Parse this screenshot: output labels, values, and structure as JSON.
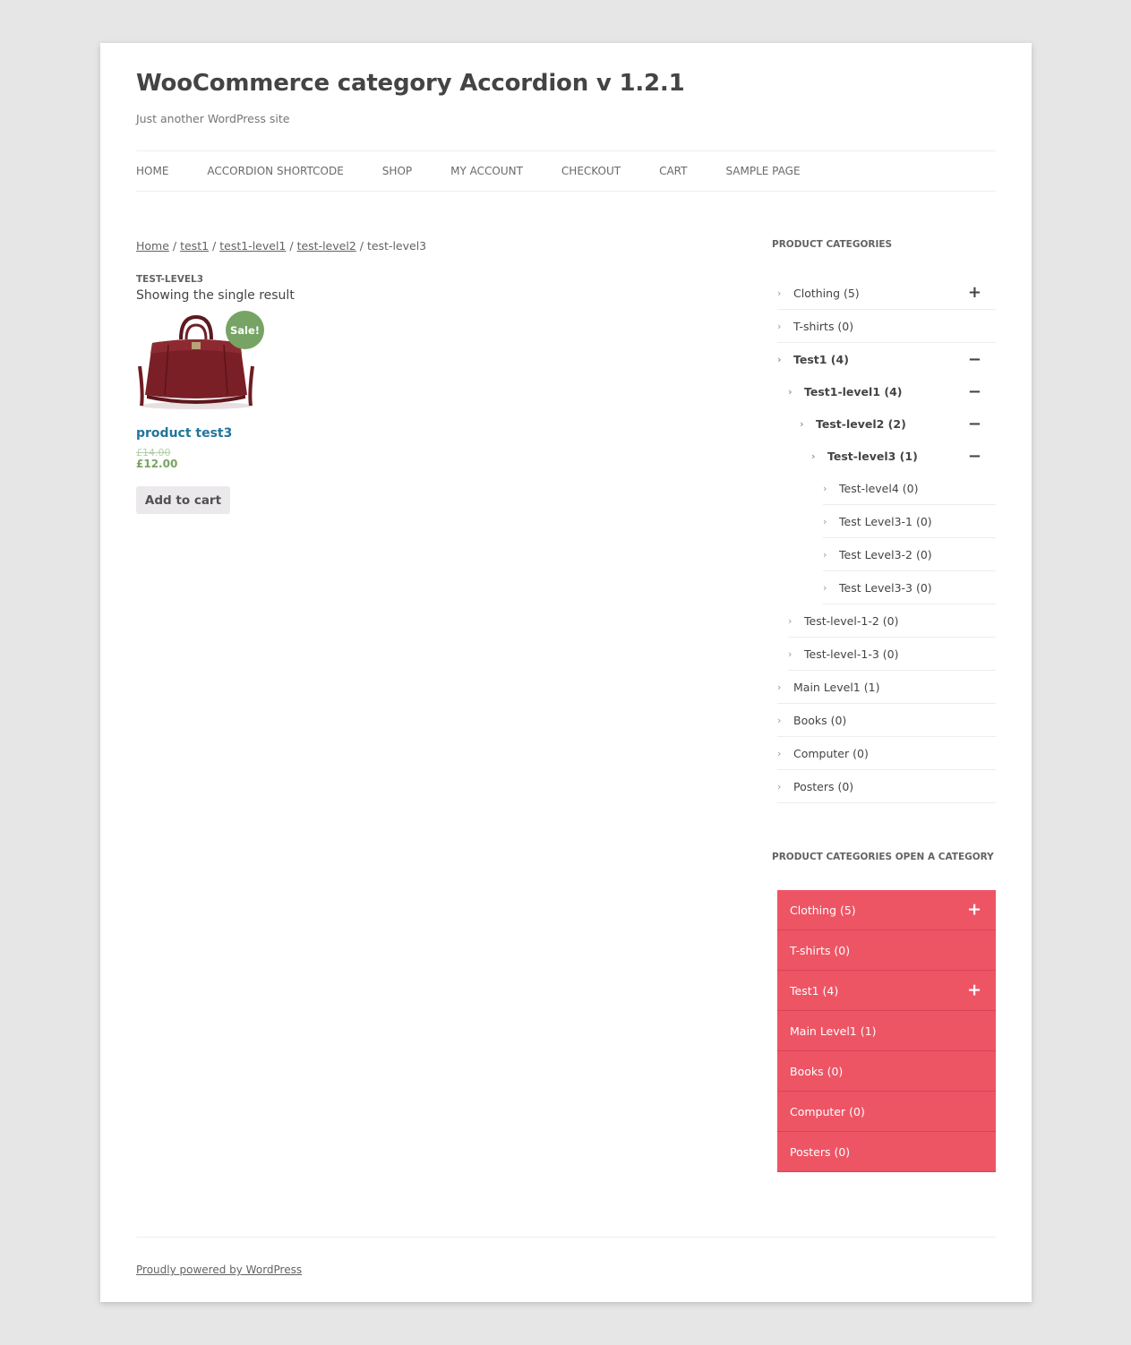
{
  "site": {
    "title": "WooCommerce category Accordion v 1.2.1",
    "description": "Just another WordPress site"
  },
  "nav": [
    "HOME",
    "ACCORDION SHORTCODE",
    "SHOP",
    "MY ACCOUNT",
    "CHECKOUT",
    "CART",
    "SAMPLE PAGE"
  ],
  "breadcrumb": {
    "links": [
      "Home",
      "test1",
      "test1-level1",
      "test-level2"
    ],
    "current": "test-level3",
    "separator": " / "
  },
  "archive": {
    "title": "TEST-LEVEL3",
    "result_count": "Showing the single result"
  },
  "product": {
    "name": "product test3",
    "sale_badge": "Sale!",
    "old_price": "£14.00",
    "new_price": "£12.00",
    "add_to_cart": "Add to cart",
    "image_icon": "handbag-image"
  },
  "widget1": {
    "title": "PRODUCT CATEGORIES",
    "items": [
      {
        "label": "Clothing (5)",
        "level": 0,
        "toggle": "+",
        "active": false
      },
      {
        "label": "T-shirts (0)",
        "level": 0,
        "toggle": "",
        "active": false
      },
      {
        "label": "Test1 (4)",
        "level": 0,
        "toggle": "−",
        "active": true
      },
      {
        "label": "Test1-level1 (4)",
        "level": 1,
        "toggle": "−",
        "active": true
      },
      {
        "label": "Test-level2 (2)",
        "level": 2,
        "toggle": "−",
        "active": true
      },
      {
        "label": "Test-level3 (1)",
        "level": 3,
        "toggle": "−",
        "active": true
      },
      {
        "label": "Test-level4 (0)",
        "level": 4,
        "toggle": "",
        "active": false
      },
      {
        "label": "Test Level3-1 (0)",
        "level": 4,
        "toggle": "",
        "active": false
      },
      {
        "label": "Test Level3-2 (0)",
        "level": 4,
        "toggle": "",
        "active": false
      },
      {
        "label": "Test Level3-3 (0)",
        "level": 4,
        "toggle": "",
        "active": false
      },
      {
        "label": "Test-level-1-2 (0)",
        "level": 1,
        "toggle": "",
        "active": false
      },
      {
        "label": "Test-level-1-3 (0)",
        "level": 1,
        "toggle": "",
        "active": false
      },
      {
        "label": "Main Level1 (1)",
        "level": 0,
        "toggle": "",
        "active": false
      },
      {
        "label": "Books (0)",
        "level": 0,
        "toggle": "",
        "active": false
      },
      {
        "label": "Computer (0)",
        "level": 0,
        "toggle": "",
        "active": false
      },
      {
        "label": "Posters (0)",
        "level": 0,
        "toggle": "",
        "active": false
      }
    ]
  },
  "widget2": {
    "title": "PRODUCT CATEGORIES OPEN A CATEGORY",
    "accent": "#ed5565",
    "items": [
      {
        "label": "Clothing (5)",
        "toggle": "+"
      },
      {
        "label": "T-shirts (0)",
        "toggle": ""
      },
      {
        "label": "Test1 (4)",
        "toggle": "+"
      },
      {
        "label": "Main Level1 (1)",
        "toggle": ""
      },
      {
        "label": "Books (0)",
        "toggle": ""
      },
      {
        "label": "Computer (0)",
        "toggle": ""
      },
      {
        "label": "Posters (0)",
        "toggle": ""
      }
    ]
  },
  "footer": {
    "credit": "Proudly powered by WordPress"
  },
  "colors": {
    "sale_green": "#77a464",
    "link_blue": "#21759b"
  }
}
